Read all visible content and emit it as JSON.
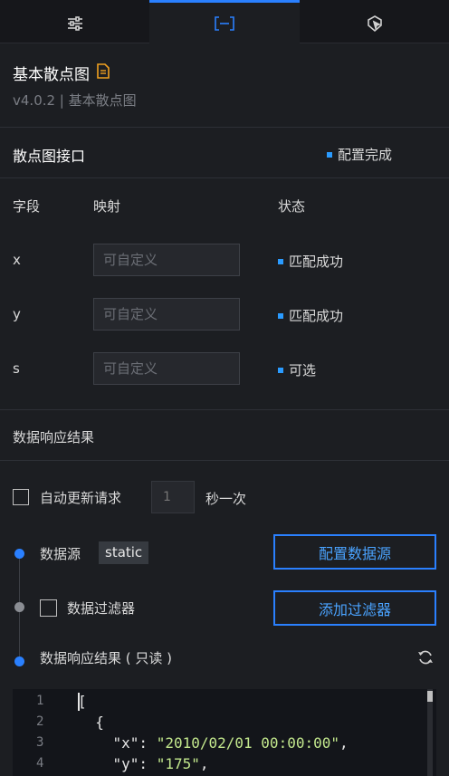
{
  "tabs": [
    {
      "name": "style",
      "icon": "sliders-icon"
    },
    {
      "name": "data",
      "icon": "data-bracket-icon",
      "active": true
    },
    {
      "name": "interaction",
      "icon": "cursor-pointer-icon"
    }
  ],
  "component": {
    "title": "基本散点图",
    "version_line": "v4.0.2 | 基本散点图"
  },
  "interface": {
    "title": "散点图接口",
    "status": "配置完成",
    "headers": {
      "field": "字段",
      "mapping": "映射",
      "status": "状态"
    },
    "rows": [
      {
        "field": "x",
        "placeholder": "可自定义",
        "status": "匹配成功"
      },
      {
        "field": "y",
        "placeholder": "可自定义",
        "status": "匹配成功"
      },
      {
        "field": "s",
        "placeholder": "可自定义",
        "status": "可选"
      }
    ]
  },
  "response": {
    "title": "数据响应结果",
    "auto_update_label": "自动更新请求",
    "interval_placeholder": "1",
    "interval_unit": "秒一次",
    "datasource_label": "数据源",
    "datasource_value": "static",
    "config_datasource_button": "配置数据源",
    "filter_label": "数据过滤器",
    "add_filter_button": "添加过滤器",
    "result_readonly_label": "数据响应结果 ( 只读 )"
  },
  "editor": {
    "line_numbers": [
      "1",
      "2",
      "3",
      "4"
    ],
    "lines": {
      "l1": "[",
      "l2": "  {",
      "l3_key": "    \"x\": ",
      "l3_val": "\"2010/02/01 00:00:00\"",
      "l3_end": ",",
      "l4_key": "    \"y\": ",
      "l4_val": "\"175\"",
      "l4_end": ","
    }
  },
  "colors": {
    "accent": "#2a80ff",
    "status_dot": "#2a9bff",
    "background": "#1c1e22",
    "string": "#c3e88d"
  }
}
